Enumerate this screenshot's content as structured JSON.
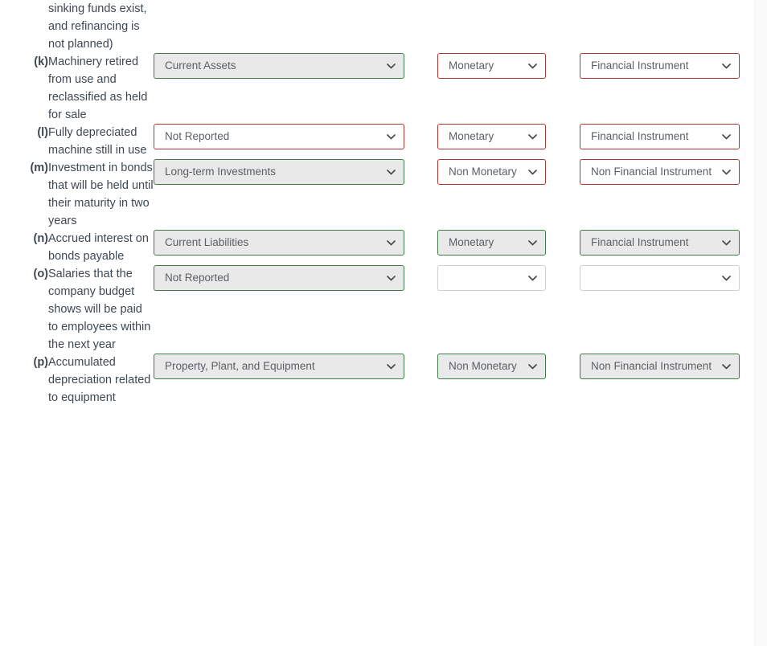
{
  "page": {
    "accent_correct": "#3d7a44",
    "accent_incorrect": "#b03535",
    "accent_neutral": "#cfcfcf",
    "text_color": "#3d4852",
    "fill_correct": "#e9e9e9",
    "fill_default": "#ffffff"
  },
  "rows": [
    {
      "label": "",
      "description": "sinking funds exist, and refinancing is not planned)",
      "is_continuation": true,
      "classification": null,
      "monetary": null,
      "instrument": null
    },
    {
      "label": "(k)",
      "description": "Machinery retired from use and reclassified as held for sale",
      "is_continuation": false,
      "classification": {
        "value": "Current Assets",
        "state": "correct"
      },
      "monetary": {
        "value": "Monetary",
        "state": "incorrect"
      },
      "instrument": {
        "value": "Financial Instrument",
        "state": "incorrect"
      }
    },
    {
      "label": "(l)",
      "description": "Fully depreciated machine still in use",
      "is_continuation": false,
      "classification": {
        "value": "Not Reported",
        "state": "incorrect"
      },
      "monetary": {
        "value": "Monetary",
        "state": "incorrect"
      },
      "instrument": {
        "value": "Financial Instrument",
        "state": "incorrect"
      }
    },
    {
      "label": "(m)",
      "description": "Investment in bonds that will be held until their maturity in two years",
      "is_continuation": false,
      "classification": {
        "value": "Long-term Investments",
        "state": "correct"
      },
      "monetary": {
        "value": "Non Monetary",
        "state": "incorrect"
      },
      "instrument": {
        "value": "Non Financial Instrument",
        "state": "incorrect"
      }
    },
    {
      "label": "(n)",
      "description": "Accrued interest on bonds payable",
      "is_continuation": false,
      "classification": {
        "value": "Current Liabilities",
        "state": "correct"
      },
      "monetary": {
        "value": "Monetary",
        "state": "correct"
      },
      "instrument": {
        "value": "Financial Instrument",
        "state": "correct"
      }
    },
    {
      "label": "(o)",
      "description": "Salaries that the company budget shows will be paid to employees within the next year",
      "is_continuation": false,
      "classification": {
        "value": "Not Reported",
        "state": "correct"
      },
      "monetary": {
        "value": "",
        "state": "empty"
      },
      "instrument": {
        "value": "",
        "state": "empty"
      }
    },
    {
      "label": "(p)",
      "description": "Accumulated depreciation related to equipment",
      "is_continuation": false,
      "classification": {
        "value": "Property, Plant, and Equipment",
        "state": "correct"
      },
      "monetary": {
        "value": "Non Monetary",
        "state": "correct"
      },
      "instrument": {
        "value": "Non Financial Instrument",
        "state": "correct"
      }
    }
  ]
}
